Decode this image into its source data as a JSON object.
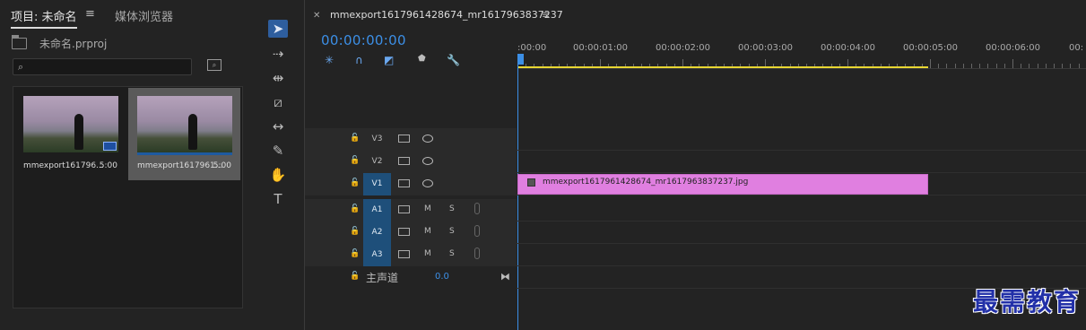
{
  "project_panel": {
    "tabs": [
      {
        "label": "项目: 未命名"
      },
      {
        "label": "媒体浏览器"
      }
    ],
    "menu_icon": "≡",
    "project_file": "未命名.prproj",
    "search_value": "",
    "clips": [
      {
        "name": "mmexport161796...",
        "duration": "5:00"
      },
      {
        "name": "mmexport1617961...",
        "duration": "5:00"
      }
    ]
  },
  "tools": [
    "selection-tool",
    "track-select-tool",
    "ripple-edit-tool",
    "razor-tool",
    "slip-tool",
    "pen-tool",
    "hand-tool",
    "type-tool"
  ],
  "timeline": {
    "sequence_tab": "mmexport1617961428674_mr1617963837237",
    "timecode": "00:00:00:00",
    "ruler_labels": [
      ":00:00",
      "00:00:01:00",
      "00:00:02:00",
      "00:00:03:00",
      "00:00:04:00",
      "00:00:05:00",
      "00:00:06:00",
      "00:"
    ],
    "video_tracks": [
      {
        "name": "V3",
        "active": false
      },
      {
        "name": "V2",
        "active": false
      },
      {
        "name": "V1",
        "active": true
      }
    ],
    "audio_tracks": [
      {
        "name": "A1",
        "mute": "M",
        "solo": "S"
      },
      {
        "name": "A2",
        "mute": "M",
        "solo": "S"
      },
      {
        "name": "A3",
        "mute": "M",
        "solo": "S"
      }
    ],
    "master": {
      "label": "主声道",
      "value": "0.0"
    },
    "clip_v1": {
      "name": "mmexport1617961428674_mr1617963837237.jpg",
      "color": "#e07fe0"
    }
  },
  "watermark": "最需教育",
  "colors": {
    "accent": "#3c8fe6",
    "clip": "#e07fe0",
    "workarea": "#e8d632"
  }
}
